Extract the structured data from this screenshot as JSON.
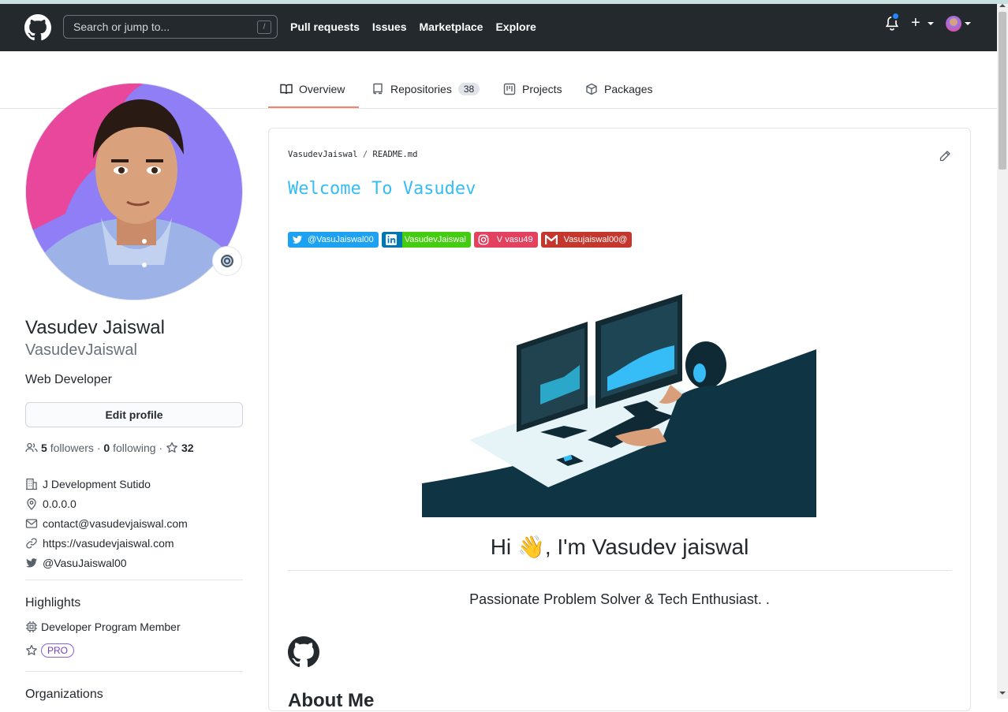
{
  "header": {
    "search_placeholder": "Search or jump to...",
    "search_key": "/",
    "nav": [
      "Pull requests",
      "Issues",
      "Marketplace",
      "Explore"
    ],
    "plus_label": "+"
  },
  "tabs": {
    "overview": "Overview",
    "repositories": "Repositories",
    "repositories_count": "38",
    "projects": "Projects",
    "packages": "Packages"
  },
  "profile": {
    "full_name": "Vasudev Jaiswal",
    "login": "VasudevJaiswal",
    "bio": "Web Developer",
    "edit_button": "Edit profile",
    "followers_count": "5",
    "followers_label": "followers",
    "dot": "·",
    "following_count": "0",
    "following_label": "following",
    "stars_count": "32",
    "company": "J Development Sutido",
    "location": "0.0.0.0",
    "email": "contact@vasudevjaiswal.com",
    "website": "https://vasudevjaiswal.com",
    "twitter": "@VasuJaiswal00"
  },
  "highlights": {
    "title": "Highlights",
    "program": "Developer Program Member",
    "pro": "PRO"
  },
  "organizations": {
    "title": "Organizations"
  },
  "readme": {
    "owner": "VasudevJaiswal",
    "slash": "/",
    "file": "README.md",
    "welcome": "Welcome To Vasudev",
    "badges": [
      {
        "label": "@VasuJaiswal00",
        "color": "#1da1f2",
        "icon": "twitter-icon"
      },
      {
        "label": "VasudevJaiswal",
        "color": "#0077b5",
        "icon": "linkedin-icon"
      },
      {
        "label": "V vasu49",
        "color": "#e4405f",
        "icon": "instagram-icon"
      },
      {
        "label": "Vasujaiswal00@",
        "color": "#d14836",
        "icon": "gmail-icon"
      }
    ],
    "hi_prefix": "Hi ",
    "wave": "👋",
    "hi_suffix": ", I'm Vasudev jaiswal",
    "tagline": "Passionate Problem Solver & Tech Enthusiast. .",
    "about": "About Me"
  },
  "colors": {
    "header_bg": "#24292e",
    "tab_accent": "#f9826c",
    "welcome": "#36bcf7",
    "pro_border": "#8a63d2"
  }
}
